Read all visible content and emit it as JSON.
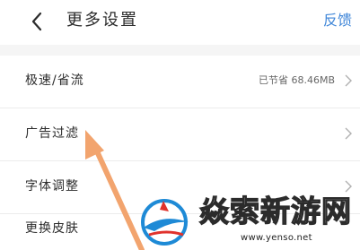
{
  "header": {
    "title": "更多设置",
    "right_link": "反馈"
  },
  "settings": {
    "items": [
      {
        "label": "极速/省流",
        "value": "已节省 68.46MB"
      },
      {
        "label": "广告过滤"
      },
      {
        "label": "字体调整"
      },
      {
        "label": "更换皮肤"
      }
    ]
  },
  "icons": {
    "back": "back-chevron-icon",
    "row_arrow": "chevron-right-icon",
    "annotation": "pointer-arrow-icon",
    "watermark_logo": "watermark-logo-icon"
  },
  "colors": {
    "link": "#3f86d8",
    "annotation_arrow": "#f2a46e",
    "watermark_blue": "#1e8ad6",
    "watermark_red": "#e0322c"
  },
  "watermark": {
    "brand": "焱索新游网",
    "url": "www.yenso.net"
  }
}
